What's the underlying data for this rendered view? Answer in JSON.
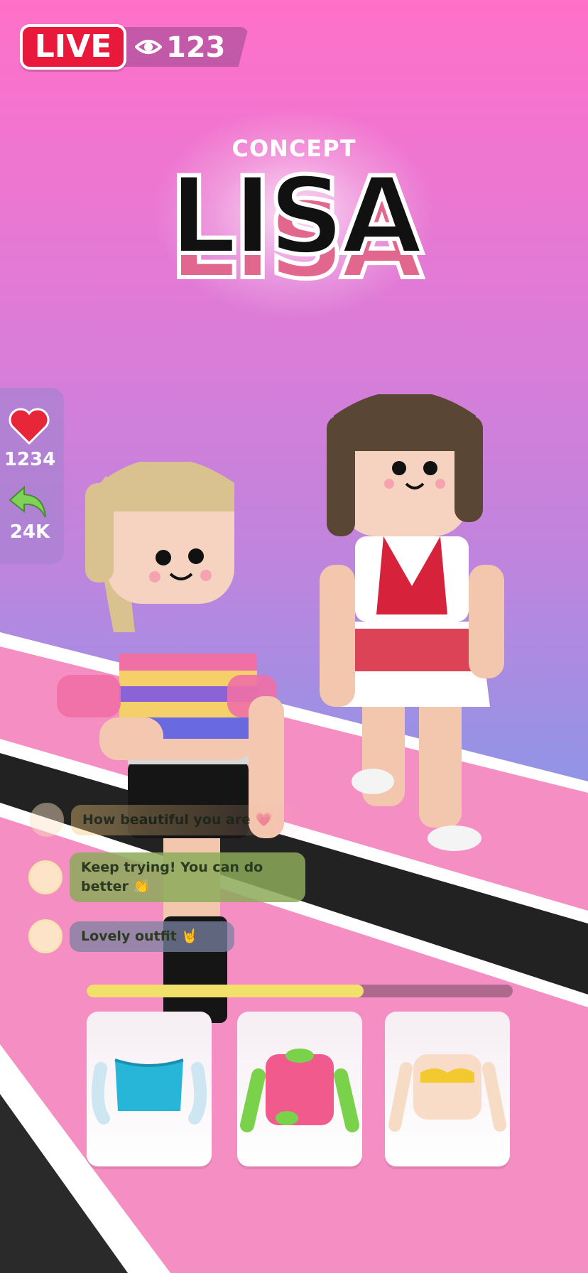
{
  "header": {
    "live_label": "LIVE",
    "viewer_count": "123"
  },
  "title": {
    "concept": "CONCEPT",
    "name": "LISA"
  },
  "stats": {
    "likes": "1234",
    "shares": "24K"
  },
  "comments": [
    {
      "text": "How beautiful you are 💗",
      "avatar": "girl-avatar"
    },
    {
      "text": "Keep trying! You can do better 👏",
      "avatar": "sunglasses-avatar"
    },
    {
      "text": "Lovely outfit 🤘",
      "avatar": "brunette-avatar"
    }
  ],
  "progress": {
    "fraction": 0.65
  },
  "items": [
    {
      "name": "blue-sequin-top"
    },
    {
      "name": "pink-green-top"
    },
    {
      "name": "yellow-bandeau-top"
    }
  ],
  "colors": {
    "live_red": "#e8193a",
    "progress_yellow": "#f1e06a",
    "runway_pink": "#f58ec2"
  }
}
